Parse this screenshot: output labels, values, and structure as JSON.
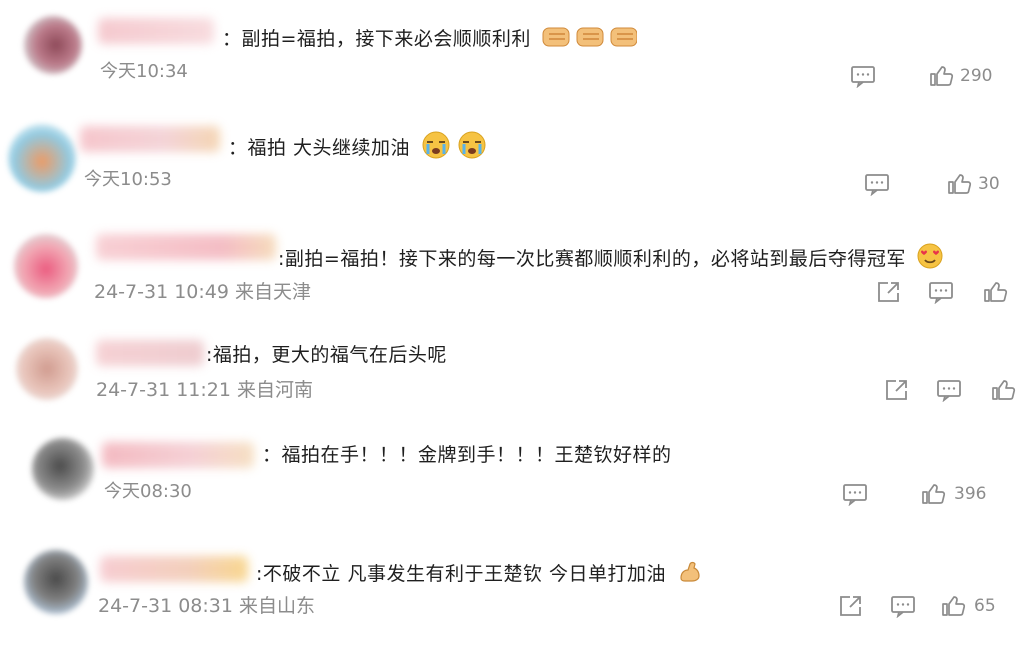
{
  "comments": [
    {
      "text": "：副拍=福拍，接下来必会顺顺利利",
      "time": "今天10:34",
      "likes": "290"
    },
    {
      "text": "：福拍 大头继续加油",
      "time": "今天10:53",
      "likes": "30"
    },
    {
      "text": ":副拍=福拍！接下来的每一次比赛都顺顺利利的，必将站到最后夺得冠军",
      "time": "24-7-31 10:49 来自天津",
      "likes": ""
    },
    {
      "text": ":福拍，更大的福气在后头呢",
      "time": "24-7-31 11:21 来自河南",
      "likes": ""
    },
    {
      "text": "：福拍在手！！！金牌到手！！！王楚钦好样的",
      "time": "今天08:30",
      "likes": "396"
    },
    {
      "text": ":不破不立 凡事发生有利于王楚钦 今日单打加油",
      "time": "24-7-31 08:31 来自山东",
      "likes": "65"
    }
  ],
  "colors": {
    "meta": "#8c8c8c",
    "text": "#1f1f1f"
  }
}
